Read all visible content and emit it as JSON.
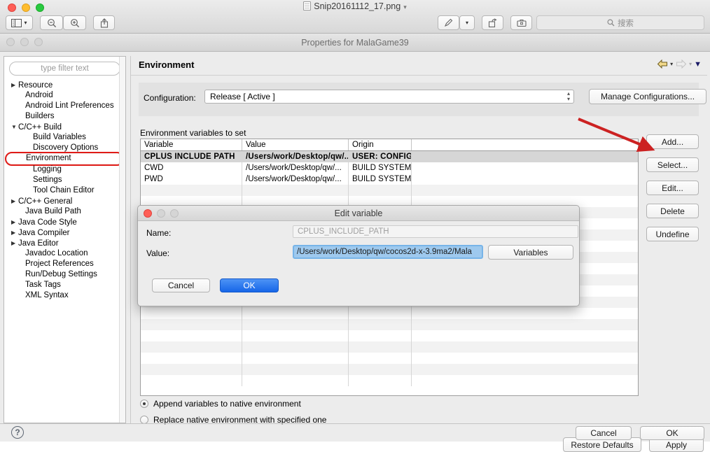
{
  "preview": {
    "document_title": "Snip20161112_17.png",
    "title_chevron": "chevron-down",
    "toolbar": {
      "sidebar_label": "sidebar-view",
      "zoom_out_label": "zoom-out",
      "zoom_in_label": "zoom-in",
      "share_label": "share",
      "markup_label": "markup",
      "rotate_label": "rotate",
      "toolkit_label": "toolkit"
    },
    "search": {
      "placeholder": "搜索",
      "value": ""
    }
  },
  "properties": {
    "window_title": "Properties for MalaGame39",
    "page_title": "Environment",
    "filter": {
      "placeholder": "type filter text",
      "value": ""
    },
    "tree": [
      {
        "label": "Resource",
        "indent": 0,
        "twisty": "collapsed",
        "selected": false
      },
      {
        "label": "Android",
        "indent": 1,
        "twisty": "none",
        "selected": false
      },
      {
        "label": "Android Lint Preferences",
        "indent": 1,
        "twisty": "none",
        "selected": false
      },
      {
        "label": "Builders",
        "indent": 1,
        "twisty": "none",
        "selected": false
      },
      {
        "label": "C/C++ Build",
        "indent": 0,
        "twisty": "expanded",
        "selected": false
      },
      {
        "label": "Build Variables",
        "indent": 2,
        "twisty": "none",
        "selected": false
      },
      {
        "label": "Discovery Options",
        "indent": 2,
        "twisty": "none",
        "selected": false
      },
      {
        "label": "Environment",
        "indent": 2,
        "twisty": "none",
        "selected": true
      },
      {
        "label": "Logging",
        "indent": 2,
        "twisty": "none",
        "selected": false
      },
      {
        "label": "Settings",
        "indent": 2,
        "twisty": "none",
        "selected": false
      },
      {
        "label": "Tool Chain Editor",
        "indent": 2,
        "twisty": "none",
        "selected": false
      },
      {
        "label": "C/C++ General",
        "indent": 0,
        "twisty": "collapsed",
        "selected": false
      },
      {
        "label": "Java Build Path",
        "indent": 1,
        "twisty": "none",
        "selected": false
      },
      {
        "label": "Java Code Style",
        "indent": 0,
        "twisty": "collapsed",
        "selected": false
      },
      {
        "label": "Java Compiler",
        "indent": 0,
        "twisty": "collapsed",
        "selected": false
      },
      {
        "label": "Java Editor",
        "indent": 0,
        "twisty": "collapsed",
        "selected": false
      },
      {
        "label": "Javadoc Location",
        "indent": 1,
        "twisty": "none",
        "selected": false
      },
      {
        "label": "Project References",
        "indent": 1,
        "twisty": "none",
        "selected": false
      },
      {
        "label": "Run/Debug Settings",
        "indent": 1,
        "twisty": "none",
        "selected": false
      },
      {
        "label": "Task Tags",
        "indent": 1,
        "twisty": "none",
        "selected": false
      },
      {
        "label": "XML Syntax",
        "indent": 1,
        "twisty": "none",
        "selected": false
      }
    ],
    "configuration": {
      "label": "Configuration:",
      "value": "Release  [ Active ]",
      "manage_button": "Manage Configurations..."
    },
    "env_section_label": "Environment variables to set",
    "table": {
      "columns": [
        "Variable",
        "Value",
        "Origin",
        ""
      ],
      "rows": [
        {
          "variable": "CPLUS INCLUDE PATH",
          "value": "/Users/work/Desktop/qw/...",
          "origin": "USER: CONFIG",
          "extra": "",
          "selected": true
        },
        {
          "variable": "CWD",
          "value": "/Users/work/Desktop/qw/...",
          "origin": "BUILD SYSTEM",
          "extra": "",
          "selected": false
        },
        {
          "variable": "PWD",
          "value": "/Users/work/Desktop/qw/...",
          "origin": "BUILD SYSTEM",
          "extra": "",
          "selected": false
        }
      ]
    },
    "side_buttons": [
      "Add...",
      "Select...",
      "Edit...",
      "Delete",
      "Undefine"
    ],
    "radios": [
      {
        "label": "Append variables to native environment",
        "checked": true
      },
      {
        "label": "Replace native environment with specified one",
        "checked": false
      }
    ],
    "restore_button": "Restore Defaults",
    "apply_button": "Apply",
    "footer": {
      "help_glyph": "?",
      "cancel_button": "Cancel",
      "ok_button": "OK"
    },
    "nav": {
      "back": "back-arrow",
      "forward": "forward-arrow",
      "menu": "chevron-down"
    }
  },
  "edit_dialog": {
    "title": "Edit variable",
    "name_label": "Name:",
    "name_placeholder": "CPLUS_INCLUDE_PATH",
    "name_value": "",
    "value_label": "Value:",
    "value_value": "/Users/work/Desktop/qw/cocos2d-x-3.9ma2/Mala",
    "variables_button": "Variables",
    "cancel_button": "Cancel",
    "ok_button": "OK"
  },
  "annotation": {
    "arrow": "red-arrow-pointing-to-add-button",
    "color": "#cc2222"
  }
}
